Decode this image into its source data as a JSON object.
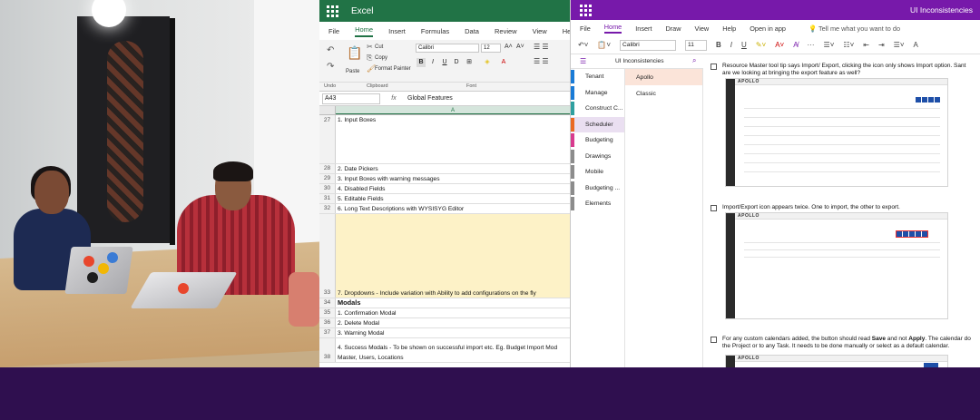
{
  "excel": {
    "app_title": "Excel",
    "tabs": [
      "File",
      "Home",
      "Insert",
      "Formulas",
      "Data",
      "Review",
      "View",
      "Help"
    ],
    "active_tab": "Home",
    "ribbon": {
      "undo": "Undo",
      "paste": "Paste",
      "cut": "Cut",
      "copy": "Copy",
      "format_painter": "Format Painter",
      "clipboard": "Clipboard",
      "font_name": "Calibri",
      "font_size": "12",
      "font_group": "Font"
    },
    "name_box": "A43",
    "formula_content": "Global Features",
    "column_header": "A",
    "rows": [
      {
        "num": "27",
        "text": "1. Input Boxes",
        "style": "tall"
      },
      {
        "num": "28",
        "text": "2. Date Pickers",
        "style": ""
      },
      {
        "num": "29",
        "text": "3. Input Boxes with warning messages",
        "style": ""
      },
      {
        "num": "30",
        "text": "4. Disabled Fields",
        "style": ""
      },
      {
        "num": "31",
        "text": "5. Editable Fields",
        "style": ""
      },
      {
        "num": "32",
        "text": "6. Long Text Descriptions with WYSISYG Editor",
        "style": ""
      },
      {
        "num": "33",
        "text": "7. Dropdowns - Include variation with Ability to add configurations on the fly",
        "style": "yellow"
      },
      {
        "num": "34",
        "text": "Modals",
        "style": "bold"
      },
      {
        "num": "35",
        "text": "1. Confirmation Modal",
        "style": ""
      },
      {
        "num": "36",
        "text": "2. Delete Modal",
        "style": ""
      },
      {
        "num": "37",
        "text": "3. Warning Modal",
        "style": ""
      },
      {
        "num": "38",
        "text": "4. Success Modals - To be shown on successful import etc. Eg. Budget Import Mod",
        "text2": "Master, Users, Locations",
        "style": "double"
      }
    ]
  },
  "onenote": {
    "app_title": "UI Inconsistencies",
    "tabs": [
      "File",
      "Home",
      "Insert",
      "Draw",
      "View",
      "Help",
      "Open in app"
    ],
    "active_tab": "Home",
    "tell_me": "Tell me what you want to do",
    "font_name": "Calibri",
    "font_size": "11",
    "notebook_name": "UI Inconsistencies",
    "sections": [
      {
        "label": "Tenant",
        "color": "#1a7bd6"
      },
      {
        "label": "Manage",
        "color": "#1a7bd6"
      },
      {
        "label": "Construct C...",
        "color": "#2fa0a0"
      },
      {
        "label": "Scheduler",
        "color": "#ea6a23"
      },
      {
        "label": "Budgeting",
        "color": "#d83b8e"
      },
      {
        "label": "Drawings",
        "color": "#8c8c8c"
      },
      {
        "label": "Mobile",
        "color": "#8c8c8c"
      },
      {
        "label": "Budgeting ...",
        "color": "#8c8c8c"
      },
      {
        "label": "Elements",
        "color": "#8c8c8c"
      }
    ],
    "active_section": "Scheduler",
    "pages": [
      "Apollo",
      "Classic"
    ],
    "active_page": "Apollo",
    "notes": {
      "n1_line1": "Resource Master tool tip says Import/ Export, clicking the icon only shows Import option. Sant",
      "n1_line2": "are we looking at bringing the export feature as well?",
      "n2": "Import/Export icon appears twice. One to import, the other to export.",
      "n3_pre": "For any custom calendars added, the button should read ",
      "n3_b1": "Save",
      "n3_mid": " and not ",
      "n3_b2": "Apply",
      "n3_post": ". The calendar do",
      "n3_line2": "the Project or to any Task. It needs to be done manually or select as a default calendar.",
      "shot_brand": "APOLLO"
    }
  },
  "colors": {
    "excel_green": "#217346",
    "onenote_purple": "#7719aa",
    "bottom_band": "#2f0f4f",
    "highlight_yellow": "#fdf2c7"
  }
}
